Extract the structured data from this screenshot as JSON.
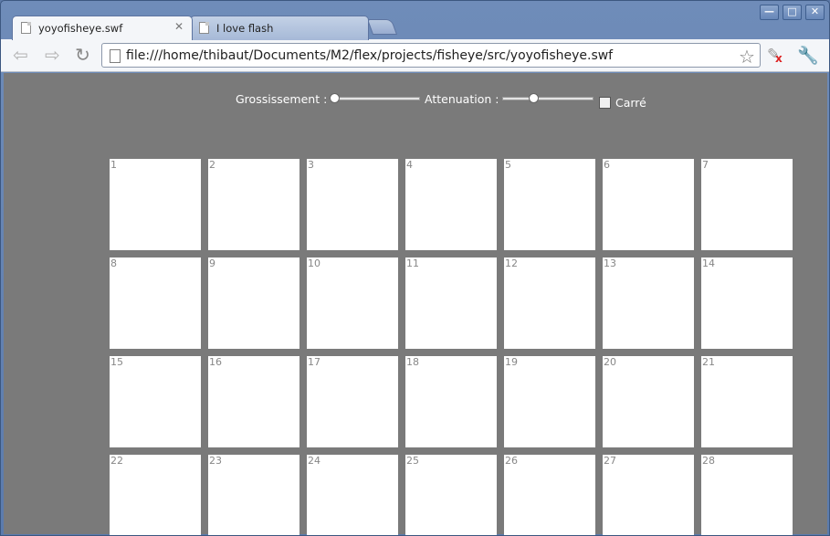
{
  "tabs": [
    {
      "title": "yoyofisheye.swf",
      "active": true
    },
    {
      "title": "I love flash",
      "active": false
    }
  ],
  "window_controls": [
    "minimize",
    "maximize",
    "close"
  ],
  "address_bar": {
    "url": "file:///home/thibaut/Documents/M2/flex/projects/fisheye/src/yoyofisheye.swf"
  },
  "controls": {
    "grossissement_label": "Grossissement :",
    "grossissement_value": 0,
    "attenuation_label": "Attenuation :",
    "attenuation_value": 0.33,
    "carre_label": "Carré",
    "carre_checked": false
  },
  "grid": {
    "columns": 7,
    "cells": [
      "1",
      "2",
      "3",
      "4",
      "5",
      "6",
      "7",
      "8",
      "9",
      "10",
      "11",
      "12",
      "13",
      "14",
      "15",
      "16",
      "17",
      "18",
      "19",
      "20",
      "21",
      "22",
      "23",
      "24",
      "25",
      "26",
      "27",
      "28"
    ]
  },
  "colors": {
    "content_bg": "#7a7a7a",
    "cell_bg": "#ffffff",
    "cell_text": "#878787",
    "title_bar": "#5d7aa8"
  }
}
